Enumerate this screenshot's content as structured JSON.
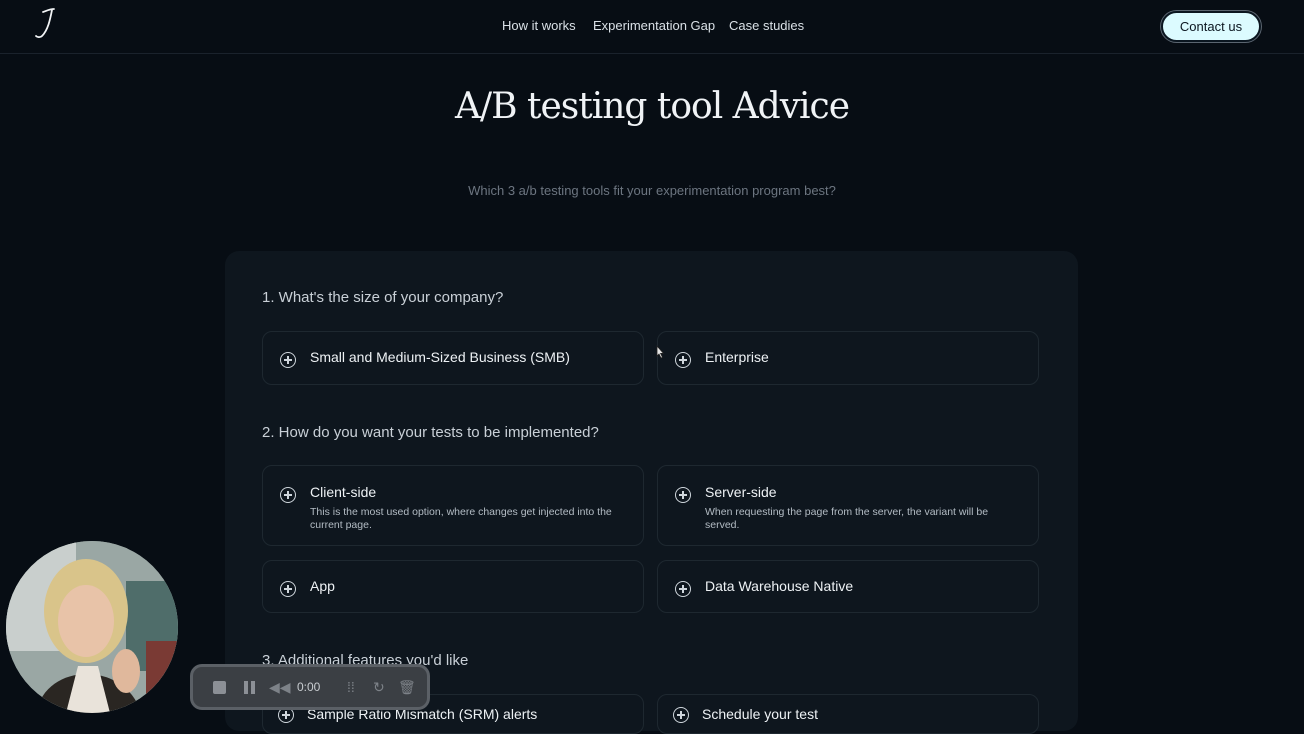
{
  "header": {
    "nav": [
      "How it works",
      "Experimentation Gap",
      "Case studies"
    ],
    "contact_label": "Contact us"
  },
  "hero": {
    "title": "A/B testing tool Advice",
    "subtitle": "Which 3 a/b testing tools fit your experimentation program best?"
  },
  "questions": [
    {
      "label": "1. What's the size of your company?",
      "options": [
        {
          "label": "Small and Medium-Sized Business (SMB)"
        },
        {
          "label": "Enterprise"
        }
      ]
    },
    {
      "label": "2. How do you want your tests to be implemented?",
      "options": [
        {
          "label": "Client-side",
          "description": "This is the most used option, where changes get injected into the current page."
        },
        {
          "label": "Server-side",
          "description": "When requesting the page from the server, the variant will be served."
        },
        {
          "label": "App"
        },
        {
          "label": "Data Warehouse Native"
        }
      ]
    },
    {
      "label": "3. Additional features you'd like",
      "options": [
        {
          "label": "Sample Ratio Mismatch (SRM) alerts"
        },
        {
          "label": "Schedule your test"
        }
      ]
    }
  ],
  "recorder": {
    "time": "0:00"
  },
  "icons": {
    "option": "plus-circle-icon",
    "logo": "logo-icon"
  }
}
